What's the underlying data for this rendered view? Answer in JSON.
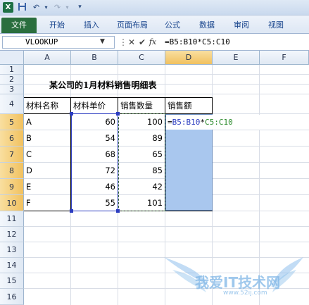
{
  "quick_access": {
    "excel_icon": "X",
    "save_icon": "save-icon",
    "undo_icon": "undo-icon",
    "redo_icon": "redo-icon",
    "customize_icon": "customize-icon"
  },
  "ribbon": {
    "tabs": [
      "文件",
      "开始",
      "插入",
      "页面布局",
      "公式",
      "数据",
      "审阅",
      "视图"
    ]
  },
  "formula_bar": {
    "name_box": "VLOOKUP",
    "cancel": "✕",
    "enter": "✔",
    "fx": "fx",
    "formula": "=B5:B10*C5:C10"
  },
  "columns": [
    "A",
    "B",
    "C",
    "D",
    "E",
    "F"
  ],
  "rows": [
    "1",
    "2",
    "3",
    "4",
    "5",
    "6",
    "7",
    "8",
    "9",
    "10",
    "11",
    "12",
    "13",
    "14",
    "15",
    "16"
  ],
  "sheet": {
    "title": "某公司的1月材料销售明细表",
    "headers": [
      "材料名称",
      "材料单价",
      "销售数量",
      "销售额"
    ],
    "data": [
      {
        "name": "A",
        "price": "60",
        "qty": "100"
      },
      {
        "name": "B",
        "price": "54",
        "qty": "89"
      },
      {
        "name": "C",
        "price": "68",
        "qty": "65"
      },
      {
        "name": "D",
        "price": "72",
        "qty": "85"
      },
      {
        "name": "E",
        "price": "46",
        "qty": "42"
      },
      {
        "name": "F",
        "price": "55",
        "qty": "101"
      }
    ],
    "editing_formula": {
      "prefix": "=",
      "range1": "B5:B10",
      "op": "*",
      "range2": "C5:C10"
    }
  },
  "watermark": {
    "text": "我爱IT技术网",
    "url": "www.52ij.com"
  },
  "colors": {
    "range1": "#2b3cc0",
    "range2": "#2a8a2a",
    "selection_fill": "#a9c7ee",
    "file_tab": "#2a6e3e"
  }
}
